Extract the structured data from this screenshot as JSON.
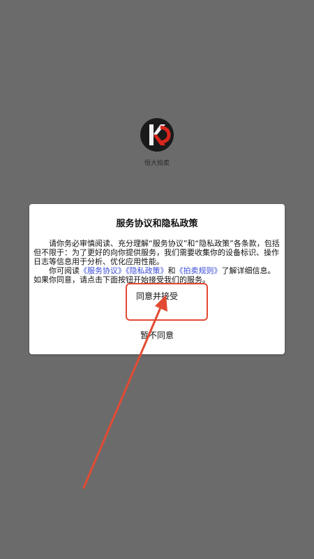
{
  "app": {
    "name": "恒大拍卖",
    "logo_text": "KD"
  },
  "dialog": {
    "title": "服务协议和隐私政策",
    "paragraph1": "请你务必审慎阅读、充分理解“服务协议”和“隐私政策”各条款，包括但不限于：为了更好的向你提供服务，我们需要收集你的设备标识、操作日志等信息用于分析、优化应用性能。",
    "p2_prefix": "你可阅读",
    "link_service": "《服务协议》",
    "link_privacy": "《隐私政策》",
    "p2_and": "和",
    "link_auction": "《拍卖规则》",
    "p2_suffix": "了解详细信息。如果你同意，请点击下面按钮开始接受我们的服务。",
    "agree_label": "同意并接受",
    "decline_label": "暂不同意"
  },
  "colors": {
    "background": "#6b6b6b",
    "link": "#3a4bd6",
    "annotation": "#e34a33"
  }
}
